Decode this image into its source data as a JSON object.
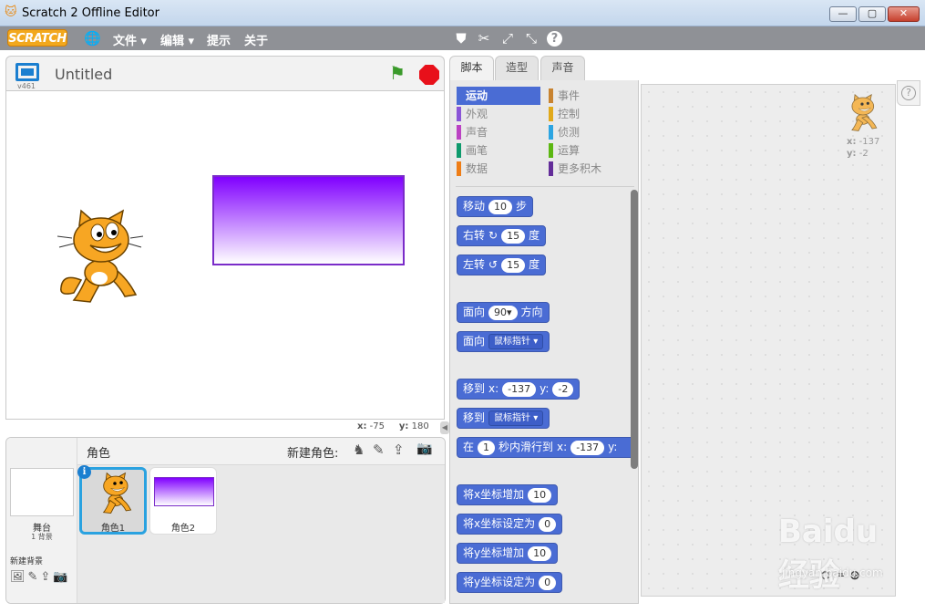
{
  "window": {
    "title": "Scratch 2 Offline Editor",
    "minimize": "—",
    "maximize": "▢",
    "close": "✕"
  },
  "menubar": {
    "logo": "SCRATCH",
    "items": [
      "文件 ▾",
      "编辑 ▾",
      "提示",
      "关于"
    ]
  },
  "stage_header": {
    "version": "v461",
    "project_title": "Untitled"
  },
  "stage_coords": {
    "x_label": "x:",
    "x": "-75",
    "y_label": "y:",
    "y": "180"
  },
  "sprites_panel": {
    "title": "角色",
    "new_sprite_label": "新建角色:",
    "stage_label": "舞台",
    "stage_backdrops": "1 背景",
    "new_backdrop_label": "新建背景",
    "sprites": [
      {
        "name": "角色1",
        "selected": true
      },
      {
        "name": "角色2",
        "selected": false
      }
    ]
  },
  "tabs": [
    {
      "label": "脚本",
      "selected": true
    },
    {
      "label": "造型",
      "selected": false
    },
    {
      "label": "声音",
      "selected": false
    }
  ],
  "categories_left": [
    {
      "label": "运动",
      "color": "#4a6cd4",
      "selected": true
    },
    {
      "label": "外观",
      "color": "#8a55d7"
    },
    {
      "label": "声音",
      "color": "#bb42c3"
    },
    {
      "label": "画笔",
      "color": "#0e9a6c"
    },
    {
      "label": "数据",
      "color": "#ee7d16"
    }
  ],
  "categories_right": [
    {
      "label": "事件",
      "color": "#c88330"
    },
    {
      "label": "控制",
      "color": "#e1a91a"
    },
    {
      "label": "侦测",
      "color": "#2ca5e2"
    },
    {
      "label": "运算",
      "color": "#5cb712"
    },
    {
      "label": "更多积木",
      "color": "#632d99"
    }
  ],
  "blocks": {
    "move": {
      "pre": "移动",
      "val": "10",
      "post": "步"
    },
    "turn_right": {
      "pre": "右转",
      "icon": "↻",
      "val": "15",
      "post": "度"
    },
    "turn_left": {
      "pre": "左转",
      "icon": "↺",
      "val": "15",
      "post": "度"
    },
    "point_dir": {
      "pre": "面向",
      "val": "90▾",
      "post": "方向"
    },
    "point_towards": {
      "pre": "面向",
      "drop": "鼠标指针 ▾"
    },
    "goto_xy": {
      "pre": "移到",
      "xl": "x:",
      "x": "-137",
      "yl": "y:",
      "y": "-2"
    },
    "goto": {
      "pre": "移到",
      "drop": "鼠标指针 ▾"
    },
    "glide": {
      "pre": "在",
      "secs": "1",
      "mid": "秒内滑行到",
      "xl": "x:",
      "x": "-137",
      "yl": "y:"
    },
    "change_x": {
      "pre": "将x坐标增加",
      "val": "10"
    },
    "set_x": {
      "pre": "将x坐标设定为",
      "val": "0"
    },
    "change_y": {
      "pre": "将y坐标增加",
      "val": "10"
    },
    "set_y": {
      "pre": "将y坐标设定为",
      "val": "0"
    }
  },
  "script_area": {
    "sprite_x_label": "x:",
    "sprite_x": "-137",
    "sprite_y_label": "y:",
    "sprite_y": "-2"
  },
  "watermark": {
    "brand": "Baidu 经验",
    "url": "jingyan.baidu.com"
  }
}
